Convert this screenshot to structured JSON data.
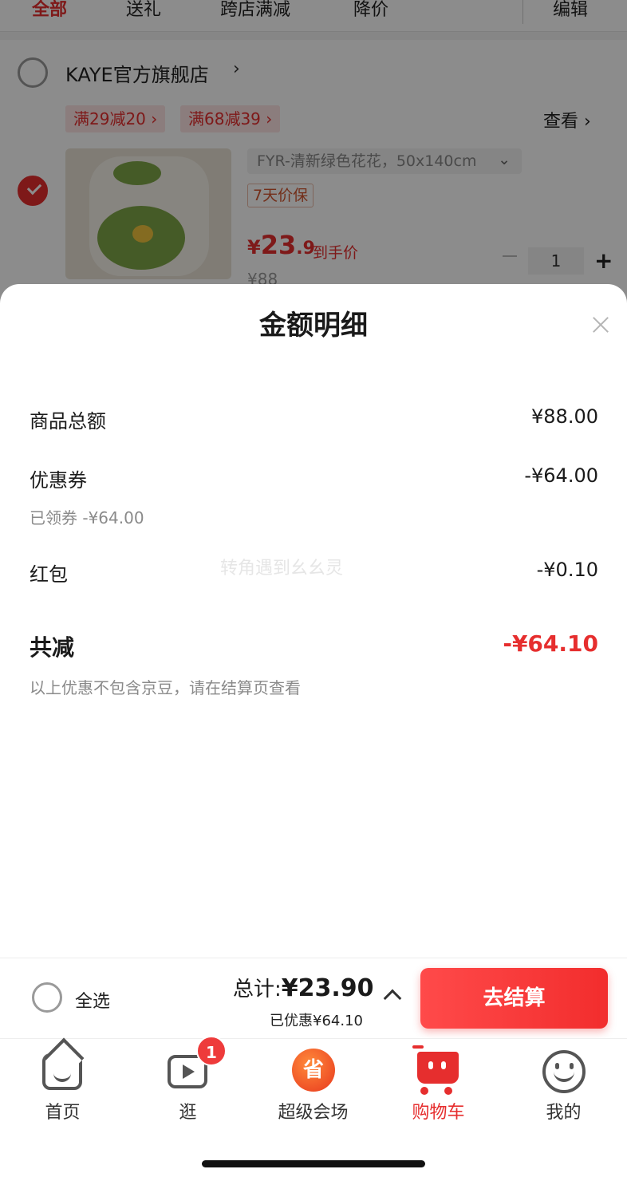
{
  "top_tabs": [
    "全部",
    "送礼",
    "跨店满减",
    "降价",
    "编辑"
  ],
  "store": {
    "name": "KAYE官方旗舰店",
    "arrow": "›",
    "promos": [
      "满29减20 ›",
      "满68减39 ›"
    ],
    "view_label": "查看 ›"
  },
  "product": {
    "variant": "FYR-清新绿色花花，50x140cm",
    "variant_caret": "⌄",
    "guarantee": "7天价保",
    "price_currency": "¥",
    "price_int": "23",
    "price_dec": ".9",
    "price_label": "到手价",
    "original_price": "¥88",
    "quantity": "1",
    "plus": "+"
  },
  "sheet": {
    "title": "金额明细",
    "rows": [
      {
        "label": "商品总额",
        "value": "¥88.00"
      },
      {
        "label": "优惠券",
        "value": "-¥64.00",
        "sub": "已领券 -¥64.00"
      },
      {
        "label": "红包",
        "value": "-¥0.10"
      }
    ],
    "total_label": "共减",
    "total_value": "-¥64.10",
    "note": "以上优惠不包含京豆，请在结算页查看",
    "watermark": "转角遇到幺幺灵"
  },
  "checkout": {
    "select_all": "全选",
    "total_label": "总计:",
    "total_amount": "¥23.90",
    "saved": "已优惠¥64.10",
    "button": "去结算"
  },
  "tabbar": {
    "items": [
      {
        "label": "首页",
        "icon": "home-icon"
      },
      {
        "label": "逛",
        "icon": "play-icon",
        "badge": "1"
      },
      {
        "label": "超级会场",
        "icon": "super-venue-icon",
        "glyph": "省"
      },
      {
        "label": "购物车",
        "icon": "cart-icon"
      },
      {
        "label": "我的",
        "icon": "smile-icon"
      }
    ]
  },
  "colors": {
    "accent": "#e62e2e",
    "muted_text": "#8a8a8a"
  }
}
